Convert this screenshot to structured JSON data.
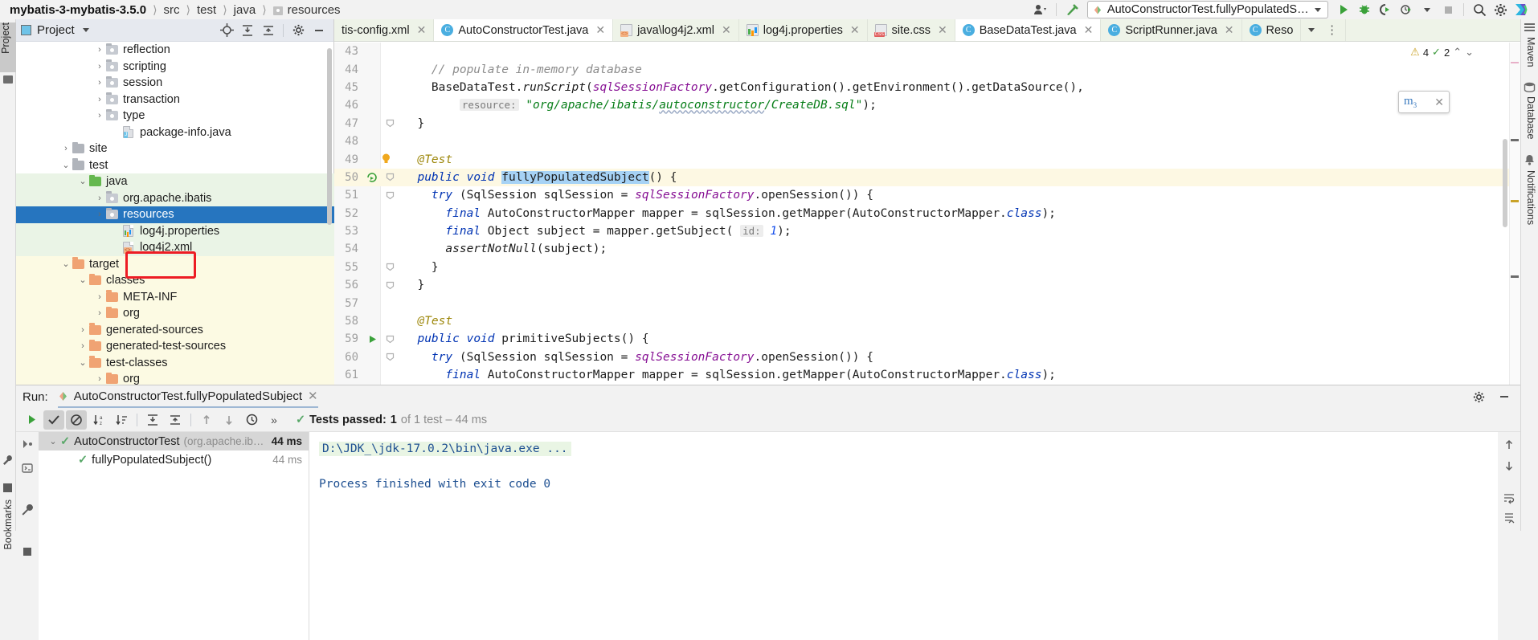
{
  "breadcrumb": {
    "project": "mybatis-3-mybatis-3.5.0",
    "items": [
      "src",
      "test",
      "java",
      "resources"
    ]
  },
  "toolbar": {
    "run_config": "AutoConstructorTest.fullyPopulatedSubject",
    "icons": [
      "user-avatar-icon",
      "hammer-build-icon",
      "run-icon",
      "debug-icon",
      "run-with-coverage-icon",
      "profile-icon",
      "stop-icon",
      "search-everywhere-icon",
      "settings-gear-icon",
      "ide-logo-icon"
    ]
  },
  "left_rail": {
    "project_tab": "Project",
    "bookmarks_tab": "Bookmarks"
  },
  "right_rail": {
    "items": [
      "Maven",
      "Database",
      "Notifications"
    ]
  },
  "project_panel": {
    "title": "Project",
    "header_icons": [
      "locate-icon",
      "expand-all-icon",
      "collapse-all-icon",
      "settings-icon",
      "hide-icon"
    ],
    "tree": [
      {
        "label": "reflection",
        "indent": 4,
        "arrow": "right",
        "icon": "package-folder",
        "bg": "white"
      },
      {
        "label": "scripting",
        "indent": 4,
        "arrow": "right",
        "icon": "package-folder",
        "bg": "white"
      },
      {
        "label": "session",
        "indent": 4,
        "arrow": "right",
        "icon": "package-folder",
        "bg": "white"
      },
      {
        "label": "transaction",
        "indent": 4,
        "arrow": "right",
        "icon": "package-folder",
        "bg": "white"
      },
      {
        "label": "type",
        "indent": 4,
        "arrow": "right",
        "icon": "package-folder",
        "bg": "white"
      },
      {
        "label": "package-info.java",
        "indent": 5,
        "arrow": "none",
        "icon": "java-file",
        "bg": "white"
      },
      {
        "label": "site",
        "indent": 2,
        "arrow": "right",
        "icon": "folder-grey",
        "bg": "white"
      },
      {
        "label": "test",
        "indent": 2,
        "arrow": "down",
        "icon": "folder-grey",
        "bg": "white"
      },
      {
        "label": "java",
        "indent": 3,
        "arrow": "down",
        "icon": "folder-green",
        "bg": "green"
      },
      {
        "label": "org.apache.ibatis",
        "indent": 4,
        "arrow": "right",
        "icon": "package-folder",
        "bg": "green"
      },
      {
        "label": "resources",
        "indent": 4,
        "arrow": "right",
        "icon": "package-folder",
        "bg": "selected"
      },
      {
        "label": "log4j.properties",
        "indent": 5,
        "arrow": "none",
        "icon": "properties-file",
        "bg": "green"
      },
      {
        "label": "log4j2.xml",
        "indent": 5,
        "arrow": "none",
        "icon": "xml-file",
        "bg": "green"
      },
      {
        "label": "target",
        "indent": 2,
        "arrow": "down",
        "icon": "folder-orange",
        "bg": "yellow"
      },
      {
        "label": "classes",
        "indent": 3,
        "arrow": "down",
        "icon": "folder-orange",
        "bg": "yellow"
      },
      {
        "label": "META-INF",
        "indent": 4,
        "arrow": "right",
        "icon": "folder-orange",
        "bg": "yellow"
      },
      {
        "label": "org",
        "indent": 4,
        "arrow": "right",
        "icon": "folder-orange",
        "bg": "yellow"
      },
      {
        "label": "generated-sources",
        "indent": 3,
        "arrow": "right",
        "icon": "folder-orange",
        "bg": "yellow"
      },
      {
        "label": "generated-test-sources",
        "indent": 3,
        "arrow": "right",
        "icon": "folder-orange",
        "bg": "yellow"
      },
      {
        "label": "test-classes",
        "indent": 3,
        "arrow": "down",
        "icon": "folder-orange",
        "bg": "yellow"
      },
      {
        "label": "org",
        "indent": 4,
        "arrow": "right",
        "icon": "folder-orange",
        "bg": "yellow"
      }
    ],
    "annotation": {
      "target": "log4j2.xml",
      "color": "#ed1c24"
    }
  },
  "editor": {
    "tabs": [
      {
        "label": "tis-config.xml",
        "icon": "xml-file-icon",
        "active": false,
        "closable": true,
        "truncated": true
      },
      {
        "label": "AutoConstructorTest.java",
        "icon": "java-class-icon",
        "active": true,
        "closable": true
      },
      {
        "label": "java\\log4j2.xml",
        "icon": "xml-file-icon",
        "active": false,
        "closable": true
      },
      {
        "label": "log4j.properties",
        "icon": "properties-file-icon",
        "active": false,
        "closable": true
      },
      {
        "label": "site.css",
        "icon": "css-file-icon",
        "active": false,
        "closable": true
      },
      {
        "label": "BaseDataTest.java",
        "icon": "java-class-icon",
        "active": true,
        "closable": true
      },
      {
        "label": "ScriptRunner.java",
        "icon": "java-class-icon",
        "active": false,
        "closable": true
      },
      {
        "label": "Reso",
        "icon": "java-class-icon",
        "active": false,
        "closable": false
      }
    ],
    "inspections": {
      "warnings": "4",
      "typos": "2"
    },
    "lines": [
      {
        "n": "43",
        "text": ""
      },
      {
        "n": "44",
        "html": "    <i class='c'>// populate in-memory database</i>"
      },
      {
        "n": "45",
        "html": "    BaseDataTest.<i class='m'>runScript</i>(<i class='f'>sqlSessionFactory</i>.getConfiguration().getEnvironment().getDataSource(),"
      },
      {
        "n": "46",
        "html": "        <span class='hint'>resource:</span> <i class='s'>\"org/apache/ibatis/<span class='squig'>autoconstructor</span>/CreateDB.sql\"</i>);"
      },
      {
        "n": "47",
        "html": "  }",
        "fold": true
      },
      {
        "n": "48",
        "text": ""
      },
      {
        "n": "49",
        "html": "  <i class='an'>@Test</i>",
        "bulb": true
      },
      {
        "n": "50",
        "html": "  <i class='k'>public</i> <i class='k'>void</i> <span class='selhl'>fullyPopulatedSubject</span>() {",
        "fold": true,
        "gutter": "run-test-icon",
        "highlight": true
      },
      {
        "n": "51",
        "html": "    <i class='k'>try</i> (SqlSession sqlSession = <i class='f'>sqlSessionFactory</i>.openSession()) {",
        "fold": true
      },
      {
        "n": "52",
        "html": "      <i class='k'>final</i> AutoConstructorMapper mapper = sqlSession.getMapper(AutoConstructorMapper.<i class='k'>class</i>);"
      },
      {
        "n": "53",
        "html": "      <i class='k'>final</i> Object subject = mapper.getSubject( <span class='hint'>id:</span> <i class='num'>1</i>);"
      },
      {
        "n": "54",
        "html": "      <i class='m'>assertNotNull</i>(subject);"
      },
      {
        "n": "55",
        "html": "    }",
        "fold": true
      },
      {
        "n": "56",
        "html": "  }",
        "fold": true
      },
      {
        "n": "57",
        "text": ""
      },
      {
        "n": "58",
        "html": "  <i class='an'>@Test</i>"
      },
      {
        "n": "59",
        "html": "  <i class='k'>public</i> <i class='k'>void</i> primitiveSubjects() {",
        "fold": true,
        "gutter": "run-arrow-icon"
      },
      {
        "n": "60",
        "html": "    <i class='k'>try</i> (SqlSession sqlSession = <i class='f'>sqlSessionFactory</i>.openSession()) {",
        "fold": true
      },
      {
        "n": "61",
        "html": "      <i class='k'>final</i> AutoConstructorMapper mapper = sqlSession.getMapper(AutoConstructorMapper.<i class='k'>class</i>);"
      }
    ]
  },
  "run_panel": {
    "label": "Run:",
    "tab_title": "AutoConstructorTest.fullyPopulatedSubject",
    "toolbar_icons": [
      "rerun-icon",
      "show-passed-icon",
      "hide-ignored-icon",
      "sort-alpha-icon",
      "sort-duration-icon",
      "expand-all-icon",
      "collapse-all-icon",
      "prev-failed-icon",
      "next-failed-icon",
      "history-icon",
      "more-icon"
    ],
    "status": {
      "prefix": "Tests passed:",
      "count": "1",
      "suffix": "of 1 test – 44 ms"
    },
    "tree": [
      {
        "name": "AutoConstructorTest",
        "package": "(org.apache.ib…",
        "time": "44 ms",
        "selected": true,
        "arrow": "down",
        "indent": 0
      },
      {
        "name": "fullyPopulatedSubject()",
        "package": "",
        "time": "44 ms",
        "selected": false,
        "arrow": "none",
        "indent": 1
      }
    ],
    "console": [
      "D:\\JDK_\\jdk-17.0.2\\bin\\java.exe ...",
      "Process finished with exit code 0"
    ],
    "left_icons": [
      "debugger-icon",
      "console-icon",
      "wrench-icon",
      "stop-square-icon"
    ],
    "right_icons": [
      "scroll-up-icon",
      "scroll-down-icon",
      "soft-wrap-icon",
      "scroll-end-icon"
    ],
    "header_icons": [
      "settings-gear-icon",
      "minimize-icon"
    ]
  },
  "colors": {
    "selection_blue": "#2675bf",
    "test_source_green": "#eaf4e6",
    "excluded_yellow": "#fcfae3",
    "annotation_red": "#ed1c24",
    "pass_green": "#59a869"
  }
}
